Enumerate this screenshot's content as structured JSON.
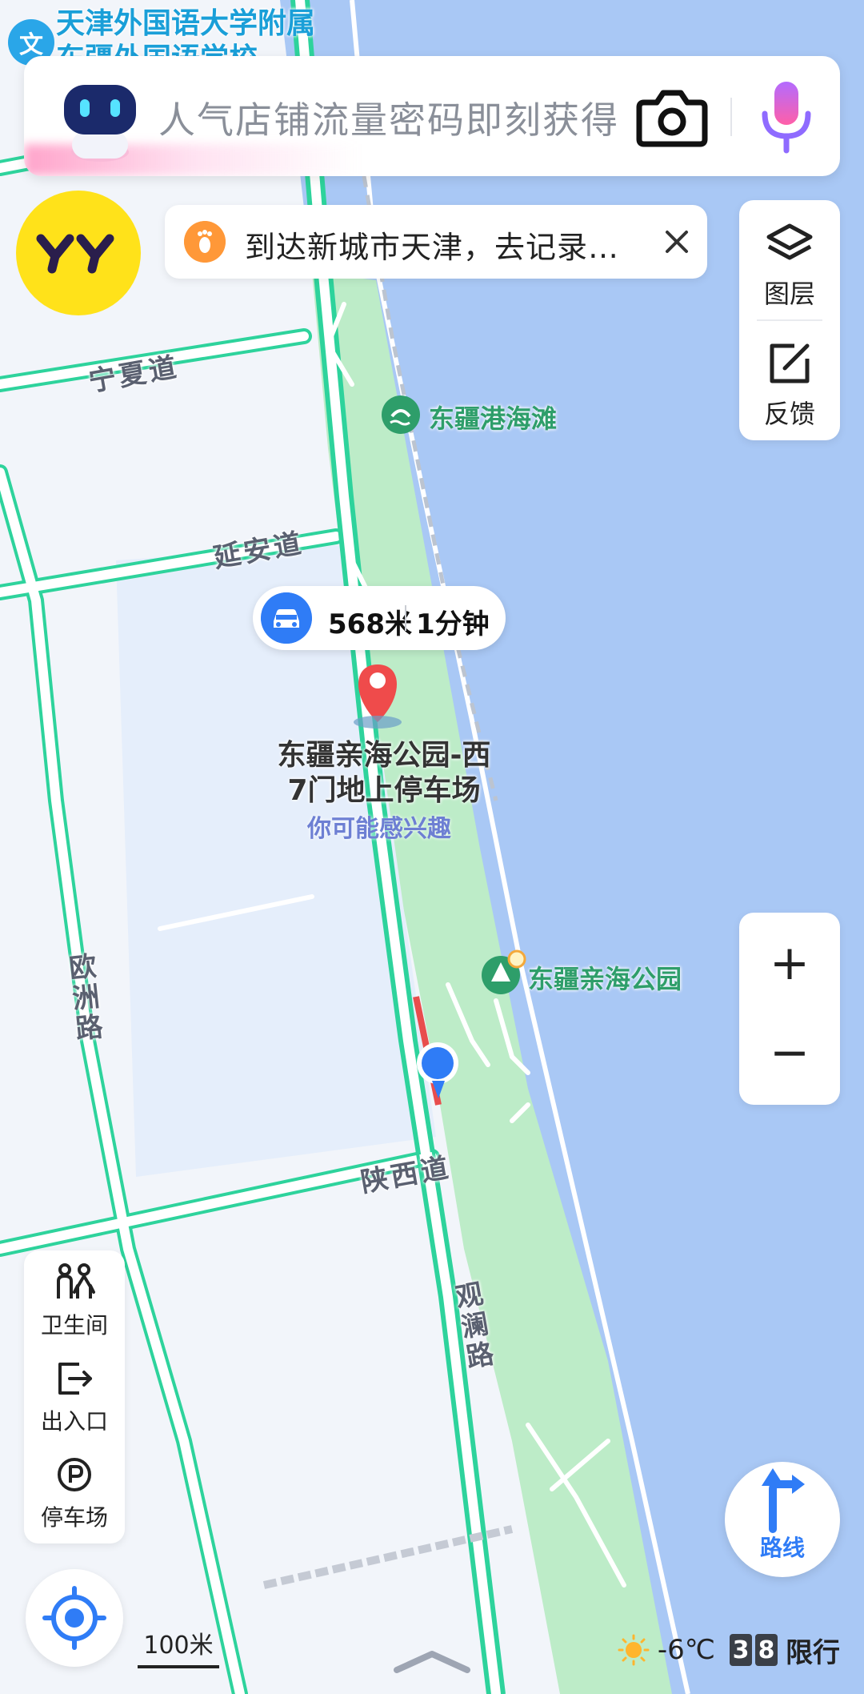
{
  "app": "map",
  "search": {
    "placeholder": "人气店铺流量密码即刻获得"
  },
  "translate_chip": "文",
  "school_label": [
    "天津外国语大学附属",
    "东疆外国语学校"
  ],
  "avatar_text": "YY",
  "notice": {
    "text": "到达新城市天津，去记录…"
  },
  "layer_panel": {
    "layers_label": "图层",
    "feedback_label": "反馈"
  },
  "roads": {
    "ningxia": "宁夏道",
    "yanan": "延安道",
    "ouzhou": "欧洲路",
    "shaanxi": "陕西道",
    "guanlan": "观澜路"
  },
  "pois": {
    "beach": "东疆港海滩",
    "park": "东疆亲海公园"
  },
  "route_summary": {
    "distance": "568米",
    "time": "1分钟"
  },
  "destination": {
    "name_line1": "东疆亲海公园-西",
    "name_line2": "7门地上停车场",
    "hint": "你可能感兴趣"
  },
  "zoom": {
    "in": "+",
    "out": "−"
  },
  "facilities": [
    {
      "icon": "restroom-icon",
      "label": "卫生间"
    },
    {
      "icon": "entrance-icon",
      "label": "出入口"
    },
    {
      "icon": "parking-icon",
      "label": "停车场"
    }
  ],
  "scale": {
    "label": "100米"
  },
  "route_button": {
    "label": "路线"
  },
  "status": {
    "temperature": "-6℃",
    "plate_digits": [
      "3",
      "8"
    ],
    "restriction_label": "限行"
  },
  "colors": {
    "road_casing": "#2ed39c",
    "park_green": "#bdecc8",
    "water_blue": "#a9c8f5",
    "accent_blue": "#2f7cf6",
    "poi_green": "#2e9e6a"
  }
}
